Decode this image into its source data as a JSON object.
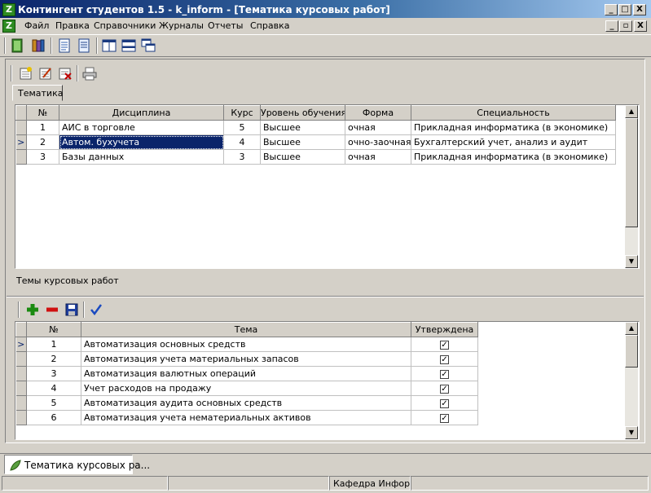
{
  "window": {
    "title": "Контингент студентов 1.5 - k_inform - [Тематика курсовых работ]",
    "app_icon": "app-logo-icon",
    "controls": {
      "minimize": "_",
      "maximize": "□",
      "close": "X",
      "child_minimize": "_",
      "child_restore": "▫",
      "child_close": "X"
    }
  },
  "menu": {
    "items": [
      "Файл",
      "Правка",
      "Справочники",
      "Журналы",
      "Отчеты",
      "Справка"
    ]
  },
  "toolbar": {
    "icons": [
      "book-green-icon",
      "books-icon",
      "document-icon",
      "document-list-icon",
      "columns-icon",
      "rows-icon",
      "windows-cascade-icon"
    ]
  },
  "subtoolbar": {
    "icons": [
      "add-record-icon",
      "edit-record-icon",
      "delete-record-icon",
      "print-icon"
    ]
  },
  "tab": {
    "label": "Тематика"
  },
  "disciplines": {
    "columns": [
      "№",
      "Дисциплина",
      "Курс",
      "Уровень обучения",
      "Форма",
      "Специальность"
    ],
    "rows": [
      [
        "1",
        "АИС в торговле",
        "5",
        "Высшее",
        "очная",
        "Прикладная информатика (в экономике)"
      ],
      [
        "2",
        "Автом. бухучета",
        "4",
        "Высшее",
        "очно-заочная",
        "Бухгалтерский учет, анализ и аудит"
      ],
      [
        "3",
        "Базы данных",
        "3",
        "Высшее",
        "очная",
        "Прикладная информатика (в экономике)"
      ]
    ],
    "current_row_marker": ">"
  },
  "topics_section": {
    "label": "Темы курсовых работ"
  },
  "topics_toolbar": {
    "icons": [
      "plus-icon",
      "minus-icon",
      "save-icon",
      "checkmark-icon"
    ]
  },
  "topics": {
    "columns": [
      "№",
      "Тема",
      "Утверждена"
    ],
    "rows": [
      [
        "1",
        "Автоматизация основных средств",
        "✓"
      ],
      [
        "2",
        "Автоматизация учета материальных запасов",
        "✓"
      ],
      [
        "3",
        "Автоматизация валютных операций",
        "✓"
      ],
      [
        "4",
        "Учет расходов на продажу",
        "✓"
      ],
      [
        "5",
        "Автоматизация аудита основных средств",
        "✓"
      ],
      [
        "6",
        "Автоматизация учета нематериальных активов",
        "✓"
      ]
    ],
    "current_row_marker": ">"
  },
  "taskbar": {
    "item": "Тематика курсовых ра..."
  },
  "statusbar": {
    "panel3": "Кафедра Информа"
  },
  "scroll": {
    "up": "▲",
    "down": "▼"
  }
}
